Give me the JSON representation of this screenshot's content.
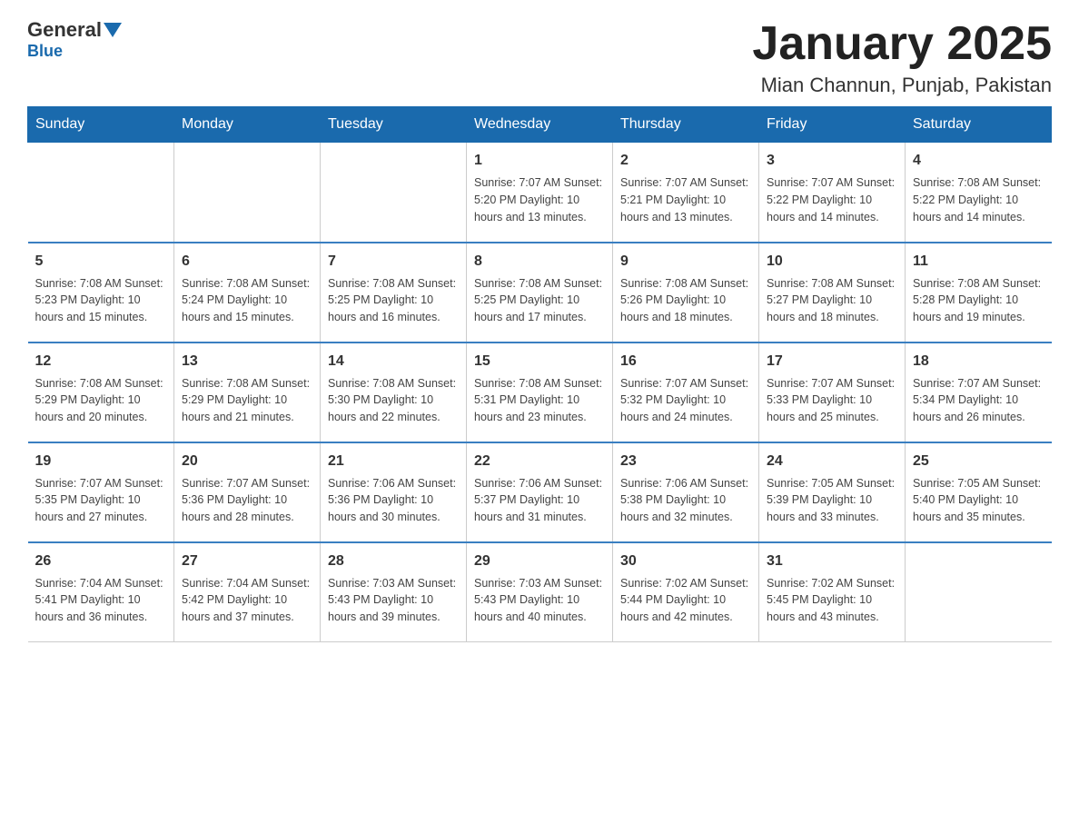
{
  "header": {
    "logo_general": "General",
    "logo_blue": "Blue",
    "main_title": "January 2025",
    "subtitle": "Mian Channun, Punjab, Pakistan"
  },
  "days_of_week": [
    "Sunday",
    "Monday",
    "Tuesday",
    "Wednesday",
    "Thursday",
    "Friday",
    "Saturday"
  ],
  "weeks": [
    [
      {
        "day": "",
        "info": ""
      },
      {
        "day": "",
        "info": ""
      },
      {
        "day": "",
        "info": ""
      },
      {
        "day": "1",
        "info": "Sunrise: 7:07 AM\nSunset: 5:20 PM\nDaylight: 10 hours\nand 13 minutes."
      },
      {
        "day": "2",
        "info": "Sunrise: 7:07 AM\nSunset: 5:21 PM\nDaylight: 10 hours\nand 13 minutes."
      },
      {
        "day": "3",
        "info": "Sunrise: 7:07 AM\nSunset: 5:22 PM\nDaylight: 10 hours\nand 14 minutes."
      },
      {
        "day": "4",
        "info": "Sunrise: 7:08 AM\nSunset: 5:22 PM\nDaylight: 10 hours\nand 14 minutes."
      }
    ],
    [
      {
        "day": "5",
        "info": "Sunrise: 7:08 AM\nSunset: 5:23 PM\nDaylight: 10 hours\nand 15 minutes."
      },
      {
        "day": "6",
        "info": "Sunrise: 7:08 AM\nSunset: 5:24 PM\nDaylight: 10 hours\nand 15 minutes."
      },
      {
        "day": "7",
        "info": "Sunrise: 7:08 AM\nSunset: 5:25 PM\nDaylight: 10 hours\nand 16 minutes."
      },
      {
        "day": "8",
        "info": "Sunrise: 7:08 AM\nSunset: 5:25 PM\nDaylight: 10 hours\nand 17 minutes."
      },
      {
        "day": "9",
        "info": "Sunrise: 7:08 AM\nSunset: 5:26 PM\nDaylight: 10 hours\nand 18 minutes."
      },
      {
        "day": "10",
        "info": "Sunrise: 7:08 AM\nSunset: 5:27 PM\nDaylight: 10 hours\nand 18 minutes."
      },
      {
        "day": "11",
        "info": "Sunrise: 7:08 AM\nSunset: 5:28 PM\nDaylight: 10 hours\nand 19 minutes."
      }
    ],
    [
      {
        "day": "12",
        "info": "Sunrise: 7:08 AM\nSunset: 5:29 PM\nDaylight: 10 hours\nand 20 minutes."
      },
      {
        "day": "13",
        "info": "Sunrise: 7:08 AM\nSunset: 5:29 PM\nDaylight: 10 hours\nand 21 minutes."
      },
      {
        "day": "14",
        "info": "Sunrise: 7:08 AM\nSunset: 5:30 PM\nDaylight: 10 hours\nand 22 minutes."
      },
      {
        "day": "15",
        "info": "Sunrise: 7:08 AM\nSunset: 5:31 PM\nDaylight: 10 hours\nand 23 minutes."
      },
      {
        "day": "16",
        "info": "Sunrise: 7:07 AM\nSunset: 5:32 PM\nDaylight: 10 hours\nand 24 minutes."
      },
      {
        "day": "17",
        "info": "Sunrise: 7:07 AM\nSunset: 5:33 PM\nDaylight: 10 hours\nand 25 minutes."
      },
      {
        "day": "18",
        "info": "Sunrise: 7:07 AM\nSunset: 5:34 PM\nDaylight: 10 hours\nand 26 minutes."
      }
    ],
    [
      {
        "day": "19",
        "info": "Sunrise: 7:07 AM\nSunset: 5:35 PM\nDaylight: 10 hours\nand 27 minutes."
      },
      {
        "day": "20",
        "info": "Sunrise: 7:07 AM\nSunset: 5:36 PM\nDaylight: 10 hours\nand 28 minutes."
      },
      {
        "day": "21",
        "info": "Sunrise: 7:06 AM\nSunset: 5:36 PM\nDaylight: 10 hours\nand 30 minutes."
      },
      {
        "day": "22",
        "info": "Sunrise: 7:06 AM\nSunset: 5:37 PM\nDaylight: 10 hours\nand 31 minutes."
      },
      {
        "day": "23",
        "info": "Sunrise: 7:06 AM\nSunset: 5:38 PM\nDaylight: 10 hours\nand 32 minutes."
      },
      {
        "day": "24",
        "info": "Sunrise: 7:05 AM\nSunset: 5:39 PM\nDaylight: 10 hours\nand 33 minutes."
      },
      {
        "day": "25",
        "info": "Sunrise: 7:05 AM\nSunset: 5:40 PM\nDaylight: 10 hours\nand 35 minutes."
      }
    ],
    [
      {
        "day": "26",
        "info": "Sunrise: 7:04 AM\nSunset: 5:41 PM\nDaylight: 10 hours\nand 36 minutes."
      },
      {
        "day": "27",
        "info": "Sunrise: 7:04 AM\nSunset: 5:42 PM\nDaylight: 10 hours\nand 37 minutes."
      },
      {
        "day": "28",
        "info": "Sunrise: 7:03 AM\nSunset: 5:43 PM\nDaylight: 10 hours\nand 39 minutes."
      },
      {
        "day": "29",
        "info": "Sunrise: 7:03 AM\nSunset: 5:43 PM\nDaylight: 10 hours\nand 40 minutes."
      },
      {
        "day": "30",
        "info": "Sunrise: 7:02 AM\nSunset: 5:44 PM\nDaylight: 10 hours\nand 42 minutes."
      },
      {
        "day": "31",
        "info": "Sunrise: 7:02 AM\nSunset: 5:45 PM\nDaylight: 10 hours\nand 43 minutes."
      },
      {
        "day": "",
        "info": ""
      }
    ]
  ]
}
